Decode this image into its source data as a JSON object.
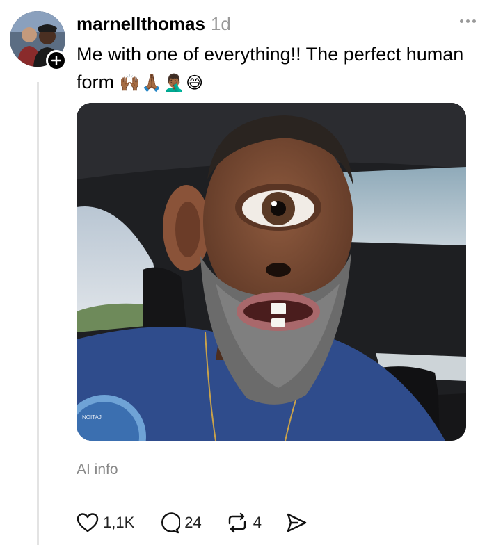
{
  "post": {
    "username": "marnellthomas",
    "time": "1d",
    "caption": "Me with one of everything!! The perfect human form",
    "caption_emojis": "🙌🏾🙏🏾🤦🏾‍♂️😅",
    "ai_label": "AI info"
  },
  "photo": {
    "shirt_badge_text": "NOITAJ"
  },
  "actions": {
    "likes": "1,1K",
    "comments": "24",
    "reposts": "4"
  },
  "icons": {
    "more": "more-options-icon",
    "follow": "plus-icon",
    "like": "heart-icon",
    "comment": "comment-icon",
    "repost": "repost-icon",
    "share": "share-icon"
  }
}
